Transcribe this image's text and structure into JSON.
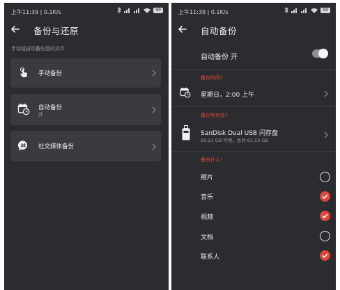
{
  "left_screen": {
    "status": {
      "time": "上午11:39",
      "speed": "0.1K/s",
      "battery": "99"
    },
    "title": "备份与还原",
    "hint": "手动或自动备份您的文件",
    "items": [
      {
        "label": "手动备份",
        "icon": "hand-touch-icon"
      },
      {
        "label": "自动备份",
        "sub": "开",
        "icon": "calendar-clock-icon"
      },
      {
        "label": "社交媒体备份",
        "icon": "chat-hash-icon"
      }
    ]
  },
  "right_screen": {
    "status": {
      "time": "上午11:39",
      "speed": "0.1K/s",
      "battery": "99"
    },
    "title": "自动备份",
    "toggle": {
      "label": "自动备份 开",
      "on": true
    },
    "when": {
      "section": "备份时间?",
      "value": "星期日，2:00 上午",
      "icon": "calendar-clock-icon"
    },
    "where": {
      "section": "备份到何处?",
      "device": "SanDisk Dual USB 闪存盘",
      "detail": "60.21 GB 可用，总共 61.53 GB",
      "icon": "usb-drive-icon"
    },
    "what": {
      "section": "备份什么?",
      "items": [
        {
          "label": "照片",
          "checked": false
        },
        {
          "label": "音乐",
          "checked": true
        },
        {
          "label": "视频",
          "checked": true
        },
        {
          "label": "文档",
          "checked": false
        },
        {
          "label": "联系人",
          "checked": true
        }
      ]
    }
  },
  "colors": {
    "background": "#2b2c2f",
    "card": "#3a3b3f",
    "accent": "#e0453a"
  }
}
